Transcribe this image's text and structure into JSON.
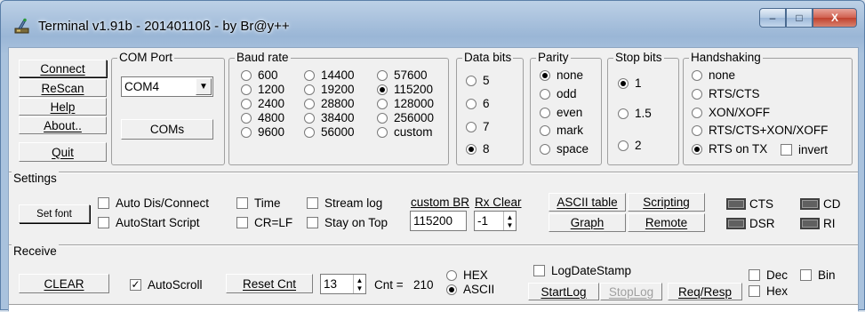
{
  "window": {
    "title": "Terminal v1.91b - 20140110ß - by Br@y++",
    "minimize": "‒",
    "maximize": "□",
    "close": "X"
  },
  "main_buttons": {
    "connect": "Connect",
    "rescan": "ReScan",
    "help": "Help",
    "about": "About..",
    "quit": "Quit"
  },
  "com_port": {
    "legend": "COM Port",
    "value": "COM4",
    "coms_button": "COMs"
  },
  "baud_rate": {
    "legend": "Baud rate",
    "options": [
      {
        "label": "600",
        "checked": false
      },
      {
        "label": "1200",
        "checked": false
      },
      {
        "label": "2400",
        "checked": false
      },
      {
        "label": "4800",
        "checked": false
      },
      {
        "label": "9600",
        "checked": false
      },
      {
        "label": "14400",
        "checked": false
      },
      {
        "label": "19200",
        "checked": false
      },
      {
        "label": "28800",
        "checked": false
      },
      {
        "label": "38400",
        "checked": false
      },
      {
        "label": "56000",
        "checked": false
      },
      {
        "label": "57600",
        "checked": false
      },
      {
        "label": "115200",
        "checked": true
      },
      {
        "label": "128000",
        "checked": false
      },
      {
        "label": "256000",
        "checked": false
      },
      {
        "label": "custom",
        "checked": false
      }
    ]
  },
  "data_bits": {
    "legend": "Data bits",
    "options": [
      {
        "label": "5",
        "checked": false
      },
      {
        "label": "6",
        "checked": false
      },
      {
        "label": "7",
        "checked": false
      },
      {
        "label": "8",
        "checked": true
      }
    ]
  },
  "parity": {
    "legend": "Parity",
    "options": [
      {
        "label": "none",
        "checked": true
      },
      {
        "label": "odd",
        "checked": false
      },
      {
        "label": "even",
        "checked": false
      },
      {
        "label": "mark",
        "checked": false
      },
      {
        "label": "space",
        "checked": false
      }
    ]
  },
  "stop_bits": {
    "legend": "Stop bits",
    "options": [
      {
        "label": "1",
        "checked": true
      },
      {
        "label": "1.5",
        "checked": false
      },
      {
        "label": "2",
        "checked": false
      }
    ]
  },
  "handshaking": {
    "legend": "Handshaking",
    "options": [
      {
        "label": "none",
        "checked": false
      },
      {
        "label": "RTS/CTS",
        "checked": false
      },
      {
        "label": "XON/XOFF",
        "checked": false
      },
      {
        "label": "RTS/CTS+XON/XOFF",
        "checked": false
      },
      {
        "label": "RTS on TX",
        "checked": true
      }
    ],
    "invert_label": "invert",
    "invert_checked": false
  },
  "settings": {
    "legend": "Settings",
    "set_font": "Set font",
    "auto_dis_connect": "Auto Dis/Connect",
    "autostart_script": "AutoStart Script",
    "time": "Time",
    "cr_lf": "CR=LF",
    "stream_log": "Stream log",
    "stay_on_top": "Stay on Top",
    "custom_br_label": "custom BR",
    "custom_br_value": "115200",
    "rx_clear_label": "Rx Clear",
    "rx_clear_value": "-1",
    "ascii_table": "ASCII table",
    "scripting": "Scripting",
    "graph": "Graph",
    "remote": "Remote",
    "indicators": {
      "cts": "CTS",
      "cd": "CD",
      "dsr": "DSR",
      "ri": "RI"
    }
  },
  "receive": {
    "legend": "Receive",
    "clear": "CLEAR",
    "autoscroll": "AutoScroll",
    "autoscroll_checked": true,
    "reset_cnt": "Reset Cnt",
    "cnt_spin_value": "13",
    "cnt_label": "Cnt =",
    "cnt_value": "210",
    "hex": "HEX",
    "ascii": "ASCII",
    "ascii_checked": true,
    "log_date_stamp": "LogDateStamp",
    "start_log": "StartLog",
    "stop_log": "StopLog",
    "req_resp": "Req/Resp",
    "dec": "Dec",
    "bin": "Bin",
    "hex_check": "Hex"
  },
  "colors": {
    "title_bar": "#a9c2dd",
    "client_bg": "#f0f0f0",
    "close_button": "#c0412e"
  }
}
